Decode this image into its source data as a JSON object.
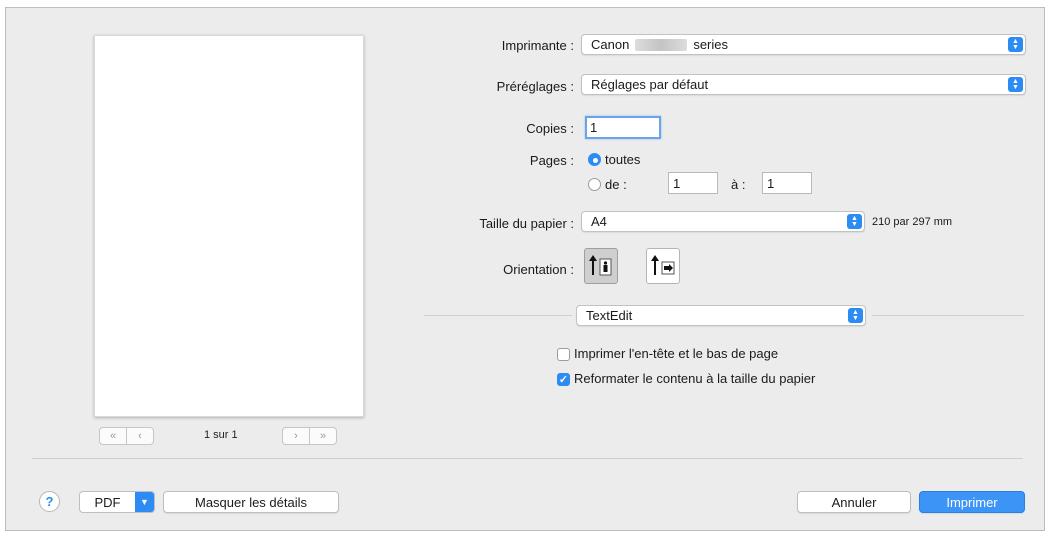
{
  "preview": {
    "page_count": "1 sur 1",
    "nav_first": "«",
    "nav_prev": "‹",
    "nav_next": "›",
    "nav_last": "»"
  },
  "printer": {
    "label": "Imprimante :",
    "value_prefix": "Canon",
    "value_suffix": "series"
  },
  "presets": {
    "label": "Préréglages :",
    "value": "Réglages par défaut"
  },
  "copies": {
    "label": "Copies :",
    "value": "1"
  },
  "pages": {
    "label": "Pages :",
    "option_all": "toutes",
    "option_from": "de :",
    "from_value": "1",
    "to_label": "à :",
    "to_value": "1"
  },
  "paper_size": {
    "label": "Taille du papier :",
    "value": "A4",
    "dimensions": "210 par 297 mm"
  },
  "orientation": {
    "label": "Orientation :",
    "selected": "portrait"
  },
  "app_menu": {
    "value": "TextEdit"
  },
  "options": {
    "header_footer": {
      "label": "Imprimer l'en-tête et le bas de page",
      "checked": false
    },
    "reformat": {
      "label": "Reformater le contenu à la taille du papier",
      "checked": true
    }
  },
  "footer": {
    "help": "?",
    "pdf": "PDF",
    "hide_details": "Masquer les détails",
    "cancel": "Annuler",
    "print": "Imprimer"
  },
  "colors": {
    "accent": "#2c8cf4",
    "background": "#ececec"
  }
}
